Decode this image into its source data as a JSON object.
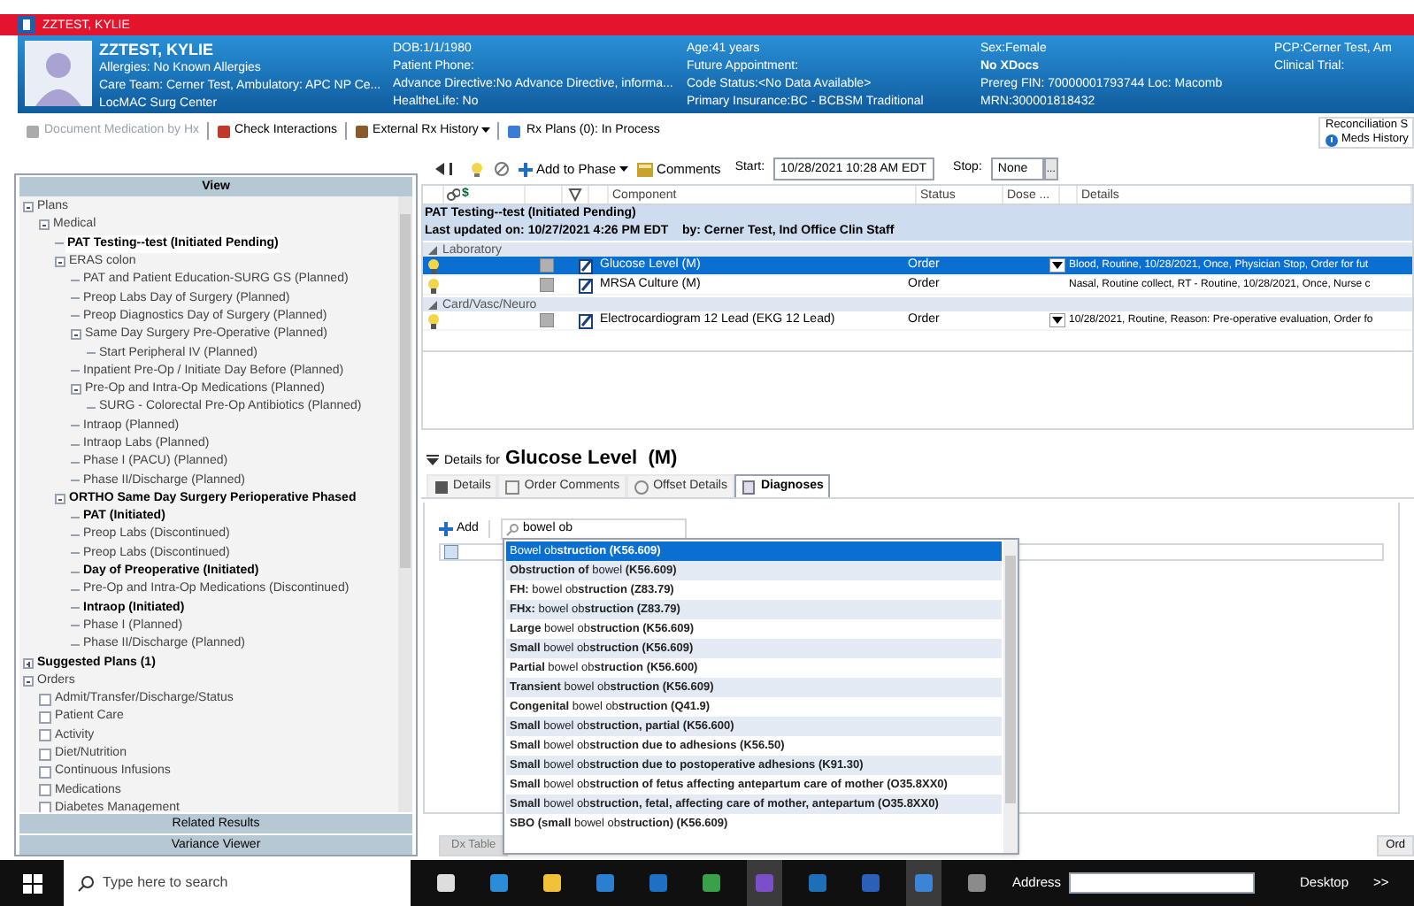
{
  "title_bar": {
    "title": "ZZTEST, KYLIE"
  },
  "banner": {
    "name": "ZZTEST, KYLIE",
    "columns": [
      [
        "Allergies: No Known Allergies",
        "Care Team: Cerner Test, Ambulatory: APC NP Ce...",
        "LocMAC Surg Center"
      ],
      [
        "DOB:1/1/1980",
        "Patient Phone:",
        "Advance Directive:No Advance Directive, informa...",
        "HealtheLife: No"
      ],
      [
        "Age:41 years",
        "Future Appointment:",
        "Code Status:<No Data Available>",
        "Primary Insurance:BC - BCBSM Traditional"
      ],
      [
        "Sex:Female",
        "**No XDocs**",
        "Prereg FIN: 70000001793744 Loc: Macomb",
        "MRN:300001818432"
      ],
      [
        "PCP:Cerner Test, Am",
        "Clinical Trial:"
      ]
    ]
  },
  "toolbar": [
    {
      "label": "Document Medication by Hx",
      "disabled": true
    },
    {
      "label": "Check Interactions",
      "disabled": false
    },
    {
      "label": "External Rx History",
      "disabled": false
    },
    {
      "label": "Rx Plans (0): In Process",
      "disabled": false
    }
  ],
  "reconciliation": {
    "title": "Reconciliation S",
    "item": "Meds History"
  },
  "left_panel": {
    "header": "View",
    "tree": [
      {
        "label": "Plans",
        "bold": false,
        "expanded": true,
        "children": [
          {
            "label": "Medical",
            "bold": false,
            "expanded": true,
            "children": [
              {
                "label": "PAT Testing--test (Initiated Pending)",
                "bold": true,
                "selected": true
              },
              {
                "label": "ERAS colon",
                "bold": false,
                "expanded": true,
                "children": [
                  {
                    "label": "PAT and Patient Education-SURG GS (Planned)",
                    "bold": false
                  },
                  {
                    "label": "Preop Labs Day of Surgery (Planned)",
                    "bold": false
                  },
                  {
                    "label": "Preop Diagnostics Day of Surgery (Planned)",
                    "bold": false
                  },
                  {
                    "label": "Same Day Surgery Pre-Operative (Planned)",
                    "bold": false,
                    "expanded": true,
                    "children": [
                      {
                        "label": "Start Peripheral IV (Planned)",
                        "bold": false
                      }
                    ]
                  },
                  {
                    "label": "Inpatient Pre-Op  / Initiate Day Before (Planned)",
                    "bold": false
                  },
                  {
                    "label": "Pre-Op and Intra-Op Medications (Planned)",
                    "bold": false,
                    "expanded": true,
                    "children": [
                      {
                        "label": "SURG - Colorectal Pre-Op Antibiotics (Planned)",
                        "bold": false
                      }
                    ]
                  },
                  {
                    "label": "Intraop (Planned)",
                    "bold": false
                  },
                  {
                    "label": "Intraop Labs (Planned)",
                    "bold": false
                  },
                  {
                    "label": "Phase I (PACU) (Planned)",
                    "bold": false
                  },
                  {
                    "label": "Phase II/Discharge (Planned)",
                    "bold": false
                  }
                ]
              },
              {
                "label": "ORTHO Same Day Surgery Perioperative Phased",
                "bold": true,
                "expanded": true,
                "children": [
                  {
                    "label": "PAT (Initiated)",
                    "bold": true
                  },
                  {
                    "label": "Preop Labs (Discontinued)",
                    "bold": false
                  },
                  {
                    "label": "Preop Labs (Discontinued)",
                    "bold": false
                  },
                  {
                    "label": "Day of Preoperative (Initiated)",
                    "bold": true
                  },
                  {
                    "label": "Pre-Op and Intra-Op Medications (Discontinued)",
                    "bold": false
                  },
                  {
                    "label": "Intraop (Initiated)",
                    "bold": true
                  },
                  {
                    "label": "Phase I (Planned)",
                    "bold": false
                  },
                  {
                    "label": "Phase II/Discharge (Planned)",
                    "bold": false
                  }
                ]
              }
            ]
          }
        ]
      },
      {
        "label": "Suggested Plans (1)",
        "bold": true,
        "expanded": false
      },
      {
        "label": "Orders",
        "bold": false,
        "expanded": true,
        "children": [
          {
            "label": "Admit/Transfer/Discharge/Status",
            "kind": "checkbox",
            "checked": false
          },
          {
            "label": "Patient Care",
            "kind": "checkbox",
            "checked": false
          },
          {
            "label": "Activity",
            "kind": "checkbox",
            "checked": false
          },
          {
            "label": "Diet/Nutrition",
            "kind": "checkbox",
            "checked": false
          },
          {
            "label": "Continuous Infusions",
            "kind": "checkbox",
            "checked": false
          },
          {
            "label": "Medications",
            "kind": "checkbox",
            "checked": false
          },
          {
            "label": "Diabetes Management",
            "kind": "checkbox",
            "checked": false
          }
        ]
      }
    ],
    "footer_buttons": [
      "Related Results",
      "Variance Viewer"
    ]
  },
  "orders": {
    "add_to_phase": "Add to Phase",
    "comments": "Comments",
    "start_label": "Start:",
    "start_value": "10/28/2021 10:28 AM EDT",
    "stop_label": "Stop:",
    "stop_value": "None",
    "more": "...",
    "columns": [
      "$",
      "Component",
      "Status",
      "Dose ...",
      "Details"
    ],
    "plan_title": "PAT Testing--test (Initiated Pending)",
    "last_updated": "Last updated on: 10/27/2021 4:26 PM EDT    by: Cerner Test, Ind Office Clin Staff",
    "groups": [
      {
        "name": "Laboratory",
        "expanded": true,
        "rows": [
          {
            "component": "Glucose Level  (M)",
            "status": "Order",
            "details": "Blood, Routine, 10/28/2021, Once, Physician Stop, Order for fut",
            "selected": true,
            "dropdown": true
          },
          {
            "component": "MRSA Culture (M)",
            "status": "Order",
            "details": "Nasal, Routine collect, RT - Routine, 10/28/2021, Once, Nurse c",
            "selected": false,
            "dropdown": false
          }
        ]
      },
      {
        "name": "Card/Vasc/Neuro",
        "expanded": true,
        "rows": [
          {
            "component": "Electrocardiogram 12 Lead (EKG 12 Lead)",
            "status": "Order",
            "details": "10/28/2021, Routine, Reason: Pre-operative evaluation, Order fo",
            "selected": false,
            "dropdown": true
          }
        ]
      }
    ]
  },
  "details": {
    "prefix": "Details for",
    "title": "Glucose Level  (M)",
    "tabs": [
      {
        "label": "Details",
        "selected": false
      },
      {
        "label": "Order Comments",
        "selected": false
      },
      {
        "label": "Offset Details",
        "selected": false
      },
      {
        "label": "Diagnoses",
        "selected": true
      }
    ],
    "add_label": "Add",
    "search_value": "bowel ob",
    "suggestions": [
      {
        "text": "Bowel ob**struction (K56.609)**",
        "selected": true
      },
      {
        "text": "**Obstruction of** bowel **(K56.609)**",
        "selected": false
      },
      {
        "text": "**FH:** bowel ob**struction (Z83.79)**",
        "selected": false
      },
      {
        "text": "**FHx:** bowel ob**struction (Z83.79)**",
        "selected": false
      },
      {
        "text": "**Large** bowel ob**struction (K56.609)**",
        "selected": false
      },
      {
        "text": "**Small** bowel ob**struction (K56.609)**",
        "selected": false
      },
      {
        "text": "**Partial** bowel ob**struction (K56.600)**",
        "selected": false
      },
      {
        "text": "**Transient** bowel ob**struction (K56.609)**",
        "selected": false
      },
      {
        "text": "**Congenital** bowel ob**struction (Q41.9)**",
        "selected": false
      },
      {
        "text": "**Small** bowel ob**struction, partial (K56.600)**",
        "selected": false
      },
      {
        "text": "**Small** bowel ob**struction due to adhesions (K56.50)**",
        "selected": false
      },
      {
        "text": "**Small** bowel ob**struction due to postoperative adhesions (K91.30)**",
        "selected": false
      },
      {
        "text": "**Small** bowel ob**struction of fetus affecting antepartum care of mother (O35.8XX0)**",
        "selected": false
      },
      {
        "text": "**Small** bowel ob**struction, fetal, affecting care of mother, antepartum (O35.8XX0)**",
        "selected": false
      },
      {
        "text": "**SBO (small** bowel ob**struction) (K56.609)**",
        "selected": false
      }
    ],
    "buttons": [
      "Dx Table",
      "Ord"
    ]
  },
  "taskbar": {
    "search_placeholder": "Type here to search",
    "address_label": "Address",
    "desktop_label": "Desktop",
    "more": ">>"
  }
}
